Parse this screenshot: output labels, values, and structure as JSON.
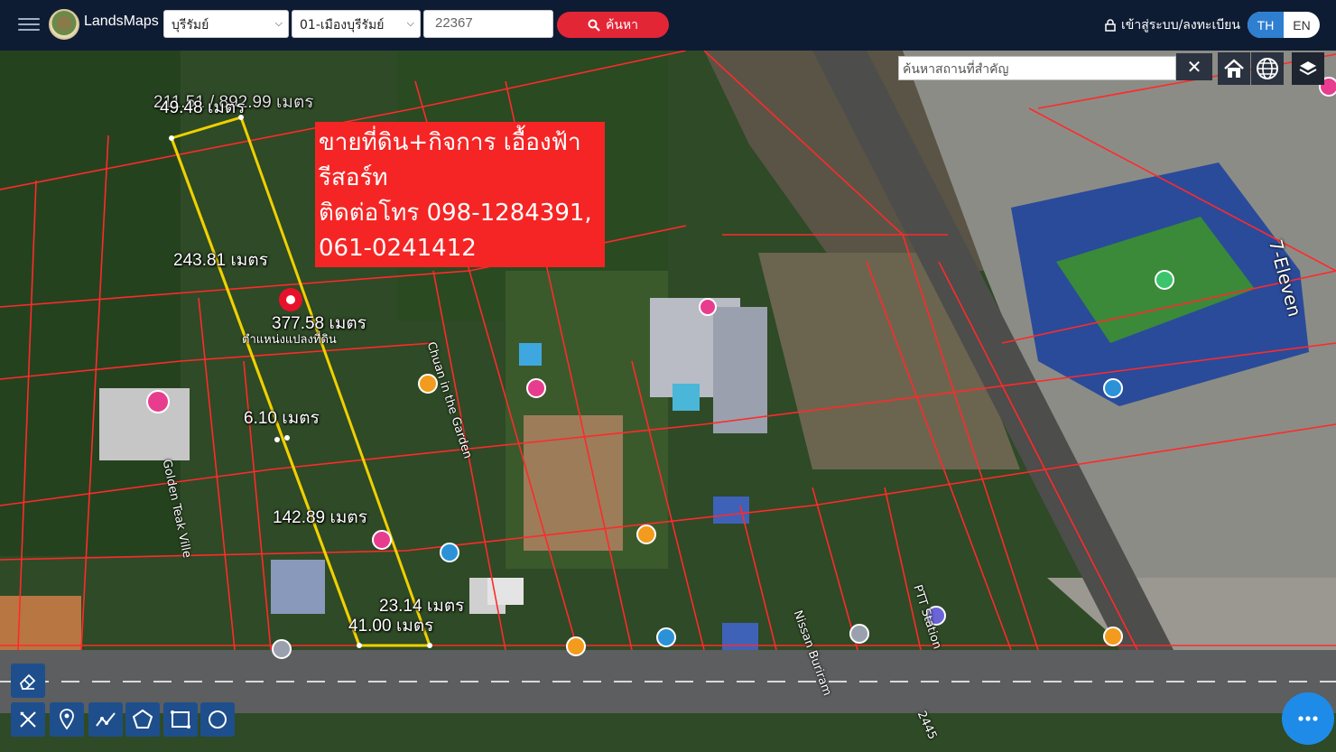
{
  "header": {
    "brand": "LandsMaps",
    "province": "บุรีรัมย์",
    "district": "01-เมืองบุรีรัมย์",
    "parcel_number": "22367",
    "search_label": "ค้นหา",
    "login_label": "เข้าสู่ระบบ/ลงทะเบียน",
    "lang_th": "TH",
    "lang_en": "EN"
  },
  "place_search": {
    "placeholder": "ค้นหาสถานที่สำคัญ",
    "clear": "✕"
  },
  "promo": {
    "line1": "ขายที่ดิน+กิจการ เอื้องฟ้า",
    "line2": "รีสอร์ท",
    "line3": "ติดต่อโทร 098-1284391,",
    "line4": "061-0241412"
  },
  "measurements": {
    "top_hidden": "211.51 / 892.99 เมตร",
    "top": "49.48 เมตร",
    "left_side": "243.81 เมตร",
    "area": "377.58 เมตร",
    "width_mid": "6.10 เมตร",
    "lower_side": "142.89 เมตร",
    "bottom1": "23.14 เมตร",
    "bottom2": "41.00 เมตร"
  },
  "map_labels": {
    "parcel_position": "ตำแหน่งแปลงที่ดิน",
    "seven_eleven": "7-Eleven",
    "chuan_garden": "Chuan in the Garden",
    "golden_teak": "Golden Teak Ville",
    "ptt_station": "PTT Station",
    "road_number": "2445",
    "nissan": "Nissan Buriram"
  },
  "colors": {
    "topbar": "#0e1c33",
    "search_button": "#e32636",
    "promo_bg": "#f52525",
    "parcel_line": "#f0d000",
    "boundary_line": "#ff2a2a",
    "lang_active": "#2f7fd1",
    "tool_bg": "#1e4f8c",
    "chat_bg": "#1f8be8"
  },
  "icons": [
    "menu-icon",
    "search-icon",
    "lock-icon",
    "close-icon",
    "home-icon",
    "globe-icon",
    "layers-icon",
    "eraser-icon",
    "clear-measure-icon",
    "pin-icon",
    "polyline-icon",
    "polygon-icon",
    "rectangle-icon",
    "circle-icon",
    "chat-icon"
  ]
}
